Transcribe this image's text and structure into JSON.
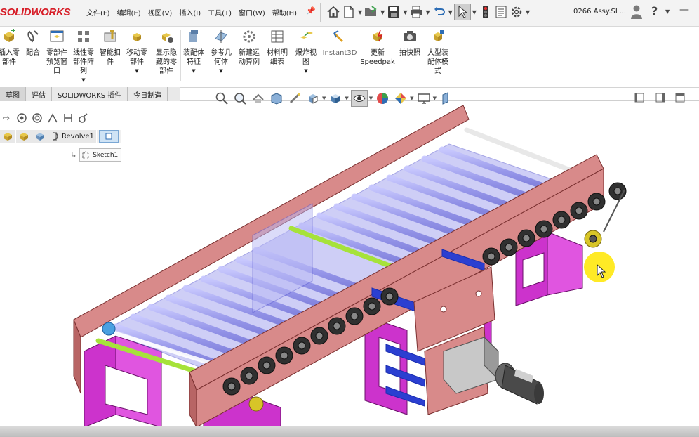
{
  "app": {
    "logo": "SOLIDWORKS",
    "menus": [
      "文件(F)",
      "编辑(E)",
      "视图(V)",
      "插入(I)",
      "工具(T)",
      "窗口(W)",
      "帮助(H)"
    ],
    "file_name": "0266 Assy.SL...",
    "help_label": "?"
  },
  "ribbon": {
    "buttons": [
      {
        "label": "插入零\n部件",
        "icon": "insert-component-icon"
      },
      {
        "label": "配合",
        "icon": "mate-icon"
      },
      {
        "label": "零部件\n预览窗\n口",
        "icon": "component-preview-icon"
      },
      {
        "label": "线性零\n部件阵\n列",
        "icon": "linear-pattern-icon"
      },
      {
        "label": "智能扣\n件",
        "icon": "smart-fastener-icon"
      },
      {
        "label": "移动零\n部件",
        "icon": "move-component-icon"
      },
      {
        "label": "显示隐\n藏的零\n部件",
        "icon": "show-hidden-icon"
      },
      {
        "label": "装配体\n特征",
        "icon": "assembly-feature-icon"
      },
      {
        "label": "参考几\n何体",
        "icon": "reference-geometry-icon"
      },
      {
        "label": "新建运\n动算例",
        "icon": "motion-study-icon"
      },
      {
        "label": "材料明\n细表",
        "icon": "bom-icon"
      },
      {
        "label": "爆炸视\n图",
        "icon": "exploded-view-icon"
      },
      {
        "label": "Instant3D",
        "icon": "instant3d-icon"
      },
      {
        "label": "更新\nSpeedpak",
        "icon": "speedpak-icon"
      },
      {
        "label": "拍快照",
        "icon": "snapshot-icon"
      },
      {
        "label": "大型装\n配体模\n式",
        "icon": "large-assembly-icon"
      }
    ]
  },
  "tabs": [
    {
      "label": "草图",
      "active": true
    },
    {
      "label": "评估",
      "active": false
    },
    {
      "label": "SOLIDWORKS 插件",
      "active": false
    },
    {
      "label": "今日制造",
      "active": false
    }
  ],
  "tree": {
    "breadcrumb_revolve": "Revolve1",
    "sketch_label": "Sketch1"
  },
  "colors": {
    "frame": "#d88a8a",
    "frame_dark": "#b86565",
    "legs": "#cc33cc",
    "rollers_blue": "#8f8fe8",
    "shaft_green": "#a6e23a",
    "blue_bar": "#2b3fd1",
    "sprocket": "#303030",
    "cursor_highlight": "#ffe600",
    "logo_red": "#d71e28"
  }
}
